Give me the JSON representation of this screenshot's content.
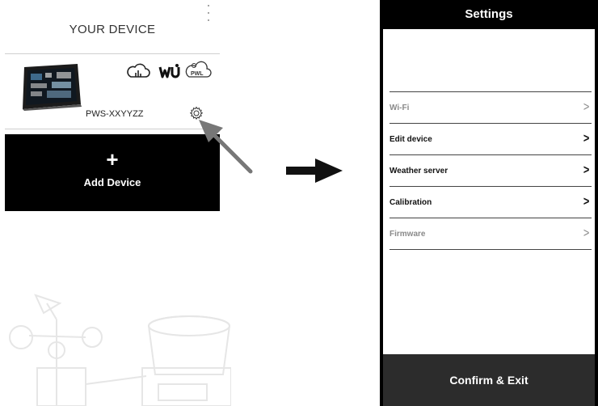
{
  "left_screen": {
    "title": "YOUR DEVICE",
    "device": {
      "name": "PWS-XXYYZZ",
      "services": [
        "cloud-chart-icon",
        "wunderground-logo",
        "pwl-logo"
      ]
    },
    "add_device": {
      "plus": "+",
      "label": "Add Device"
    }
  },
  "right_screen": {
    "title": "Settings",
    "items": [
      {
        "label": "Wi-Fi",
        "enabled": false
      },
      {
        "label": "Edit device",
        "enabled": true
      },
      {
        "label": "Weather server",
        "enabled": true
      },
      {
        "label": "Calibration",
        "enabled": true
      },
      {
        "label": "Firmware",
        "enabled": false
      }
    ],
    "confirm_label": "Confirm & Exit"
  },
  "colors": {
    "dark": "#000000",
    "confirm_bar": "#2c2c2c",
    "disabled_text": "#8a8a8a"
  }
}
